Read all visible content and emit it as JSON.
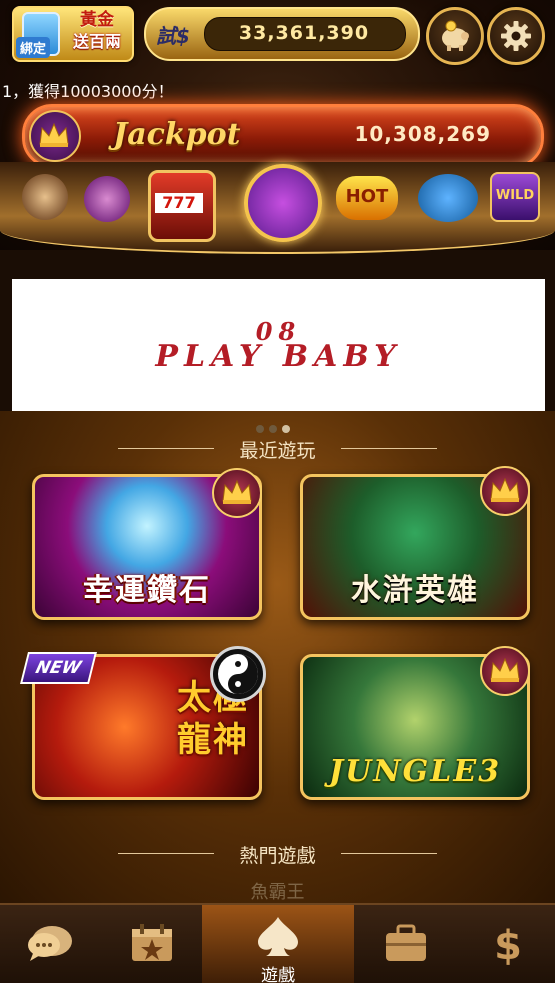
{
  "header": {
    "bind_badge": {
      "label": "綁定",
      "line1": "黃金",
      "line2": "送百兩"
    },
    "balance": {
      "currency_label": "試$",
      "amount": "33,361,390"
    },
    "piggy_icon": "piggy-bank-icon",
    "settings_icon": "gear-icon"
  },
  "marquee": {
    "text": "1，獲得10003000分！"
  },
  "jackpot": {
    "label": "Jackpot",
    "value": "10,308,269"
  },
  "game_strip": {
    "items": [
      {
        "name": "dealer-game-icon"
      },
      {
        "name": "poker-cards-game-icon"
      },
      {
        "name": "bonus-777-game-icon",
        "text": "777"
      },
      {
        "name": "featured-clock-game-icon"
      },
      {
        "name": "hot-game-icon",
        "text": "HOT"
      },
      {
        "name": "shark-game-icon"
      },
      {
        "name": "wild-game-icon",
        "text": "WILD"
      }
    ]
  },
  "banner": {
    "line1": "08",
    "line2": "PLAY BABY"
  },
  "carousel": {
    "dots": 3,
    "active_index": 1
  },
  "sections": {
    "recent": "最近遊玩",
    "hot": "熱門遊戲",
    "faded_next": "魚霸王"
  },
  "recent_games": [
    {
      "title": "幸運鑽石",
      "badge": "crown"
    },
    {
      "title": "水滸英雄",
      "badge": "crown"
    },
    {
      "title_line1": "太極",
      "title_line2": "龍神",
      "badge": "yin-yang",
      "new_label": "NEW"
    },
    {
      "title": "JUNGLE3",
      "badge": "crown"
    }
  ],
  "bottom_nav": {
    "items": [
      {
        "icon": "chat-bubble-icon"
      },
      {
        "icon": "calendar-star-icon"
      },
      {
        "icon": "spade-icon",
        "label": "遊戲",
        "active": true
      },
      {
        "icon": "briefcase-icon"
      },
      {
        "icon": "dollar-icon"
      }
    ]
  },
  "colors": {
    "accent_gold": "#f4c45f",
    "background_brown": "#5a3007",
    "jackpot_red": "#8c1b07"
  }
}
